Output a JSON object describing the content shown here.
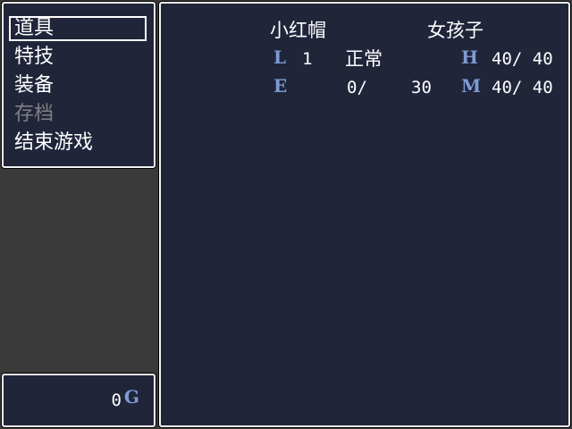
{
  "menu": {
    "items": [
      {
        "label": "道具",
        "state": "selected"
      },
      {
        "label": "特技",
        "state": "normal"
      },
      {
        "label": "装备",
        "state": "normal"
      },
      {
        "label": "存档",
        "state": "disabled"
      },
      {
        "label": "结束游戏",
        "state": "normal"
      }
    ]
  },
  "gold": {
    "amount": "0",
    "unit": "G"
  },
  "actor": {
    "name": "小红帽",
    "class": "女孩子",
    "level_label": "L",
    "level": "1",
    "state": "正常",
    "exp_label": "E",
    "exp_current": "0/",
    "exp_next": "30",
    "hp_label": "H",
    "hp": "40/ 40",
    "mp_label": "M",
    "mp": "40/ 40"
  },
  "colors": {
    "window_bg": "#20253a",
    "window_border": "#f2f2f2",
    "system_label": "#7f9bd6",
    "disabled_text": "#808080",
    "screen_bg": "#3a3a3a"
  }
}
